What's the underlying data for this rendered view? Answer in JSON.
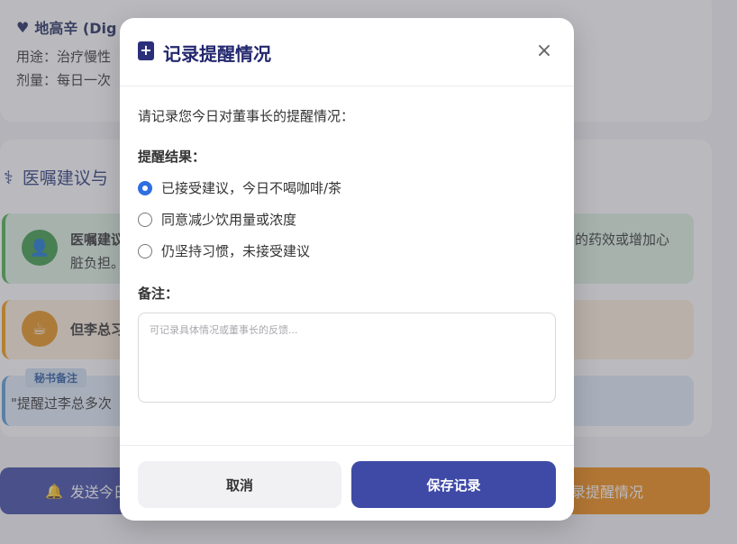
{
  "background": {
    "medication": {
      "title": "地高辛 (Dig",
      "usage_label": "用途：",
      "usage_value": "治疗慢性",
      "dose_label": "剂量：",
      "dose_value": "每日一次"
    },
    "advice_section": {
      "title": "医嘱建议与",
      "tip_green_title": "医嘱建议",
      "tip_green_line2": "脏负担。",
      "tip_green_right": "的药效或增加心",
      "tip_orange_title": "但李总习",
      "secretary_note_label": "秘书备注",
      "secretary_note_text": "\"提醒过李总多次"
    },
    "send_button": "发送今日",
    "record_button": "录提醒情况"
  },
  "modal": {
    "title": "记录提醒情况",
    "prompt": "请记录您今日对董事长的提醒情况：",
    "result_label": "提醒结果：",
    "options": [
      {
        "label": "已接受建议，今日不喝咖啡/茶",
        "checked": true
      },
      {
        "label": "同意减少饮用量或浓度",
        "checked": false
      },
      {
        "label": "仍坚持习惯，未接受建议",
        "checked": false
      }
    ],
    "note_label": "备注：",
    "note_placeholder": "可记录具体情况或董事长的反馈...",
    "note_value": "",
    "cancel_label": "取消",
    "save_label": "保存记录"
  },
  "colors": {
    "primary": "#3f4aa6",
    "radio_selected": "#2f6fe0",
    "accent_orange": "#ef8a12"
  }
}
